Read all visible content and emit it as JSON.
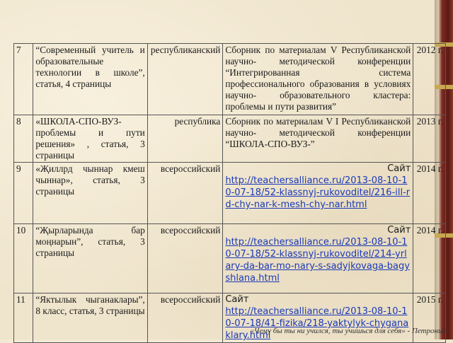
{
  "rows": [
    {
      "num": "7",
      "name": "“Современный учитель и образовательные технологии в школе”, статья, 4 страницы",
      "level": "республиканский",
      "source": "Сборник по материалам V Республиканской научно- методической конференции “Интегрированная система профессионального образования в условиях научно- образовательного кластера: проблемы и пути развития”",
      "year": "2012 г."
    },
    {
      "num": "8",
      "name": "«ШКОЛА-СПО-ВУЗ- проблемы и пути решения» , статья, 3 страницы",
      "level": "республика",
      "source": "Сборник по материалам V I Республиканской научно- методической конференции “ШКОЛА-СПО-ВУЗ-”",
      "year": "2013 г."
    },
    {
      "num": "9",
      "name": "«Җиллрд чыннар кмеш чыннар», статья, 3 страницы",
      "level": "всероссийский",
      "site_label": "Сайт",
      "url": "http://teachersalliance.ru/2013-08-10-10-07-18/52-klassnyj-rukovoditel/216-ill-rd-chy-nar-k-mesh-chy-nar.html",
      "year": "2014 г."
    },
    {
      "num": "10",
      "name": "“Җырларында бар моңнарын”, статья, 3 страницы",
      "level": "всероссийский",
      "site_label": "Сайт",
      "url": "http://teachersalliance.ru/2013-08-10-10-07-18/52-klassnyj-rukovoditel/214-yrlary-da-bar-mo-nary-s-sadyjkovaga-bagyshlana.html",
      "year": "2014 г."
    },
    {
      "num": "11",
      "name": "“Яктылык чыганаклары”, 8 класс, статья, 3 страницы",
      "level": "всероссийский",
      "site_label": "Сайт",
      "url": "http://teachersalliance.ru/2013-08-10-10-07-18/41-fizika/218-yaktylyk-chyganaklary.html",
      "year": "2015 г."
    }
  ],
  "footer_quote": "«Чему бы ты ни учился, ты учишься для себя» - Петроний"
}
